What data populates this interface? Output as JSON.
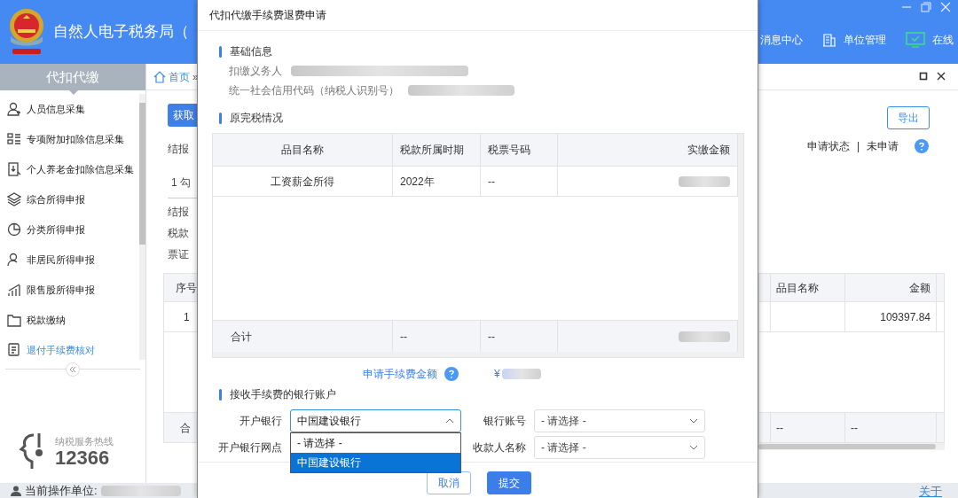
{
  "app": {
    "title": "自然人电子税务局（",
    "header_links": [
      {
        "label": "消息中心",
        "kind": "message"
      },
      {
        "label": "单位管理",
        "kind": "org"
      },
      {
        "label": "在线",
        "kind": "online"
      }
    ]
  },
  "sidebar": {
    "title": "代扣代缴",
    "items": [
      {
        "label": "人员信息采集",
        "selected": false
      },
      {
        "label": "专项附加扣除信息采集",
        "selected": false
      },
      {
        "label": "个人养老金扣除信息采集",
        "selected": false
      },
      {
        "label": "综合所得申报",
        "selected": false
      },
      {
        "label": "分类所得申报",
        "selected": false
      },
      {
        "label": "非居民所得申报",
        "selected": false
      },
      {
        "label": "限售股所得申报",
        "selected": false
      },
      {
        "label": "税款缴纳",
        "selected": false
      },
      {
        "label": "退付手续费核对",
        "selected": true
      }
    ],
    "hotline": {
      "label": "纳税服务热线",
      "number": "12366"
    }
  },
  "breadcrumb": {
    "home": "首页",
    "separator": "»"
  },
  "main_left": {
    "button": "获取",
    "lines": [
      {
        "text": "结报"
      },
      {
        "text": "1 勾",
        "kind": "tab"
      },
      {
        "text": "结报"
      },
      {
        "text": "税款"
      },
      {
        "text": "票证"
      }
    ],
    "table": {
      "column": "序号",
      "row": "1",
      "footer": "合"
    }
  },
  "main_right": {
    "export": "导出",
    "status_label": "申请状态",
    "separator": "|",
    "status_value": "未申请",
    "table": {
      "columns": [
        "品目名称",
        "金额"
      ],
      "rows": [
        {
          "amount": "109397.84"
        }
      ],
      "footer": [
        "--",
        "--"
      ]
    }
  },
  "status_bar": {
    "label": "当前操作单位:",
    "about": "关于"
  },
  "dialog": {
    "title": "代扣代缴手续费退费申请",
    "basic_info": {
      "heading": "基础信息",
      "fields": [
        {
          "label": "扣缴义务人"
        },
        {
          "label": "统一社会信用代码（纳税人识别号）"
        }
      ]
    },
    "tax_paid": {
      "heading": "原完税情况",
      "columns": [
        "品目名称",
        "税款所属时期",
        "税票号码",
        "实缴金额"
      ],
      "rows": [
        {
          "item": "工资薪金所得",
          "period": "2022年",
          "ticket_no": "--"
        }
      ],
      "total": {
        "label": "合计",
        "period": "--",
        "ticket_no": "--"
      }
    },
    "fee_amount": {
      "label": "申请手续费金额",
      "currency": "¥"
    },
    "bank_account": {
      "heading": "接收手续费的银行账户",
      "fields": [
        {
          "label": "开户银行",
          "value": "中国建设银行",
          "expanded": true,
          "options": [
            {
              "label": "- 请选择 -",
              "selected": false
            },
            {
              "label": "中国建设银行",
              "selected": true
            }
          ]
        },
        {
          "label": "银行账号",
          "value": "- 请选择 -",
          "expanded": false
        },
        {
          "label": "开户银行网点"
        },
        {
          "label": "收款人名称",
          "value": "- 请选择 -",
          "expanded": false
        }
      ]
    },
    "buttons": [
      {
        "label": "取消",
        "kind": "secondary"
      },
      {
        "label": "提交",
        "kind": "primary"
      }
    ]
  }
}
